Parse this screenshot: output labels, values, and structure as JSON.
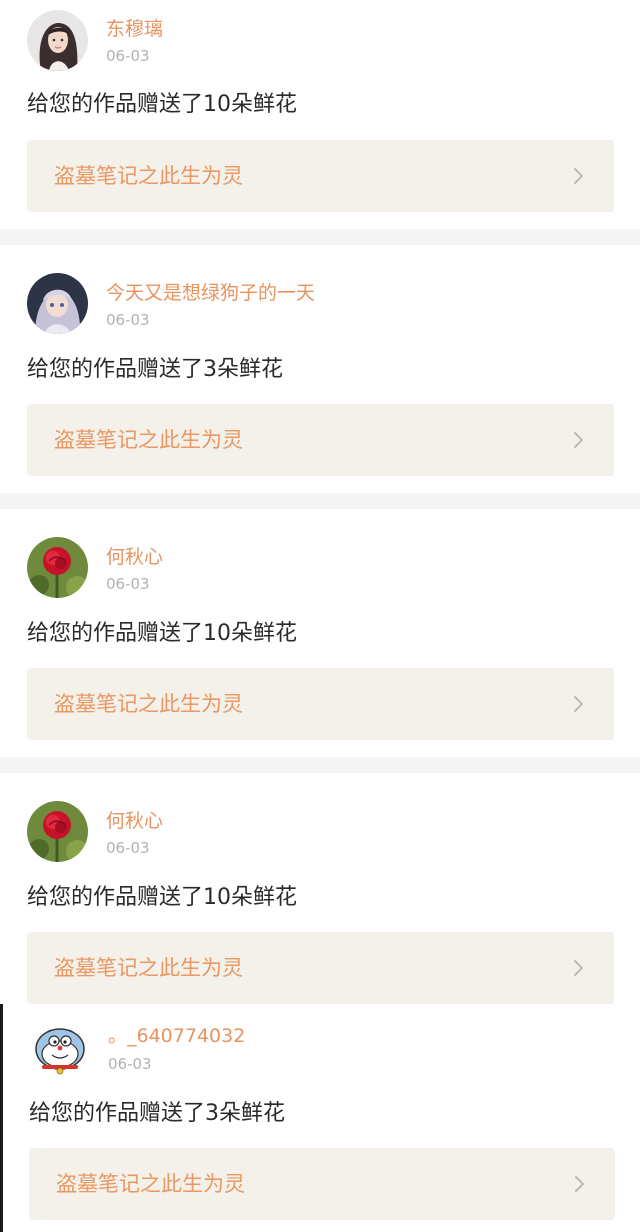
{
  "notifications": [
    {
      "user_name": "东穆璃",
      "date": "06-03",
      "message": "给您的作品赠送了10朵鲜花",
      "work_title": "盗墓笔记之此生为灵",
      "avatar_icon": "girl-portrait-avatar"
    },
    {
      "user_name": "今天又是想绿狗子的一天",
      "date": "06-03",
      "message": "给您的作品赠送了3朵鲜花",
      "work_title": "盗墓笔记之此生为灵",
      "avatar_icon": "anime-doll-avatar"
    },
    {
      "user_name": "何秋心",
      "date": "06-03",
      "message": "给您的作品赠送了10朵鲜花",
      "work_title": "盗墓笔记之此生为灵",
      "avatar_icon": "red-rose-avatar"
    },
    {
      "user_name": "何秋心",
      "date": "06-03",
      "message": "给您的作品赠送了10朵鲜花",
      "work_title": "盗墓笔记之此生为灵",
      "avatar_icon": "red-rose-avatar"
    },
    {
      "user_name": "。_640774032",
      "date": "06-03",
      "message": "给您的作品赠送了3朵鲜花",
      "work_title": "盗墓笔记之此生为灵",
      "avatar_icon": "cartoon-cat-avatar"
    }
  ],
  "colors": {
    "username": "#e9935f",
    "date": "#b2b2b2",
    "message": "#2a2a2a",
    "work_title": "#ea9761",
    "work_link_background": "#f4f1ea",
    "separator": "#f5f4f4"
  }
}
